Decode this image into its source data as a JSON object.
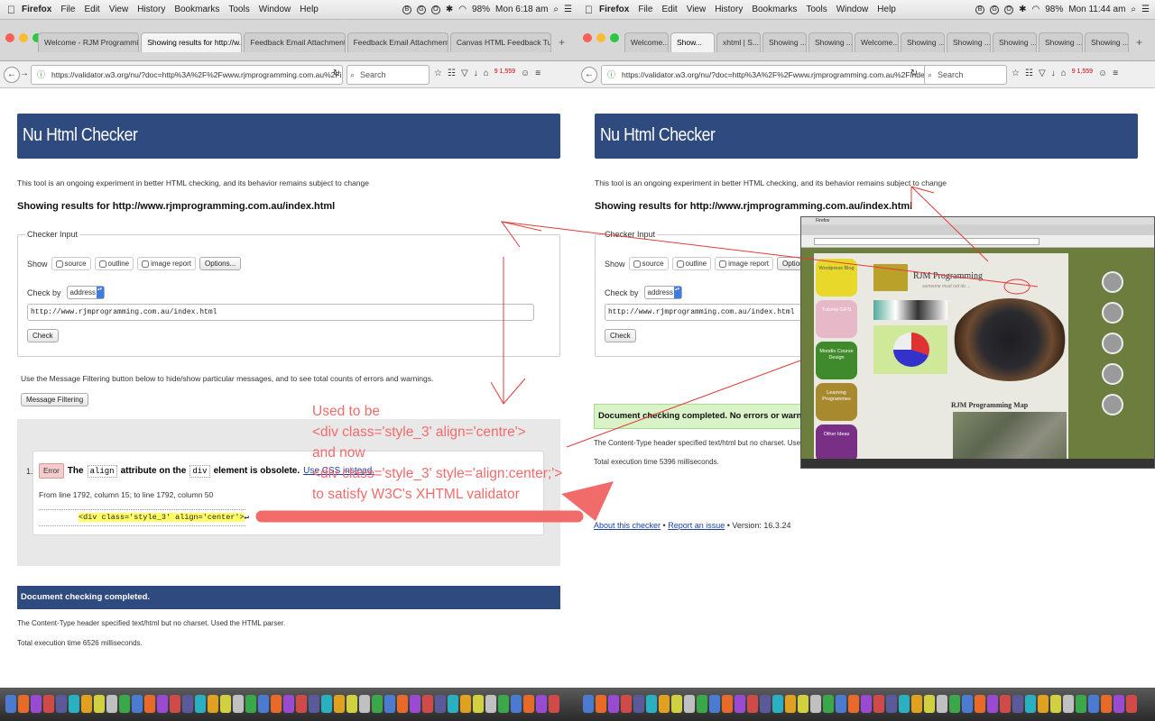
{
  "menubar": {
    "app": "Firefox",
    "items": [
      "File",
      "Edit",
      "View",
      "History",
      "Bookmarks",
      "Tools",
      "Window",
      "Help"
    ],
    "left_clock": "Mon 6:18 am",
    "right_clock": "Mon 11:44 am",
    "battery": "98%"
  },
  "left_browser": {
    "tabs": [
      {
        "label": "Welcome - RJM Programmi...",
        "active": false
      },
      {
        "label": "Showing results for http://w...",
        "active": true
      },
      {
        "label": "Feedback Email Attachment...",
        "active": false
      },
      {
        "label": "Feedback Email Attachment...",
        "active": false
      },
      {
        "label": "Canvas HTML Feedback Tu...",
        "active": false
      }
    ],
    "url": "https://validator.w3.org/nu/?doc=http%3A%2F%2Fwww.rjmprogramming.com.au%2Findex.html",
    "search_placeholder": "Search",
    "downloads_badge": "9 1,559"
  },
  "right_browser": {
    "tabs": [
      "Welcome...",
      "Show...",
      "xhtml | S...",
      "Showing ...",
      "Showing ...",
      "Welcome...",
      "Showing ...",
      "Showing ...",
      "Showing ...",
      "Showing ...",
      "Showing ..."
    ],
    "url": "https://validator.w3.org/nu/?doc=http%3A%2F%2Fwww.rjmprogramming.com.au%2Findex.html",
    "search_placeholder": "Search",
    "downloads_badge": "9 1,559"
  },
  "checker": {
    "title": "Nu Html Checker",
    "intro": "This tool is an ongoing experiment in better HTML checking, and its behavior remains subject to change",
    "showing": "Showing results for http://www.rjmprogramming.com.au/index.html",
    "legend": "Checker Input",
    "show_label": "Show",
    "options": [
      "source",
      "outline",
      "image report"
    ],
    "options_button": "Options...",
    "check_by_label": "Check by",
    "check_by_value": "address",
    "url_value": "http://www.rjmprogramming.com.au/index.html",
    "check_button": "Check",
    "filter_text": "Use the Message Filtering button below to hide/show particular messages, and to see total counts of errors and warnings.",
    "filter_button": "Message Filtering"
  },
  "error": {
    "number": "1.",
    "badge": "Error",
    "the": "The",
    "attr": "align",
    "mid": "attribute on the",
    "elem": "div",
    "end": "element is obsolete.",
    "link": "Use CSS instead.",
    "location": "From line 1792, column 15; to line 1792, column 50",
    "extract": "<div class='style_3' align='center'>",
    "extract_after": "↵"
  },
  "left_footer": {
    "completed": "Document checking completed.",
    "content_type": "The Content-Type header specified text/html but no charset. Used the HTML parser.",
    "exec": "Total execution time 6526 milliseconds."
  },
  "right_footer": {
    "completed": "Document checking completed. No errors or warnings to show.",
    "content_type": "The Content-Type header specified text/html but no charset. Used the HTML parser.",
    "exec": "Total execution time 5396 milliseconds.",
    "about": "About this checker",
    "sep1": " • ",
    "report": "Report an issue",
    "version": " • Version: 16.3.24"
  },
  "annotation": {
    "lines": [
      "Used to be",
      "<div class='style_3' align='centre'>",
      "and now",
      "<div class='style_3' style='align:center;'>",
      "to satisfy W3C's XHTML validator"
    ],
    "color": "#f26b6b"
  },
  "inset": {
    "site_title": "RJM Programming",
    "subtitle": "someone must not do ...",
    "map_title": "RJM Programming Map",
    "side_items": [
      "Wordpress Blog",
      "Tutorial GIFS",
      "Moodle Course Design",
      "Learning Programmes",
      "Other Ideas"
    ]
  },
  "colors": {
    "header_blue": "#2e4a7e",
    "error_badge": "#f3cccc",
    "success_green": "#d9f2c7",
    "annotation_red": "#f26b6b"
  }
}
